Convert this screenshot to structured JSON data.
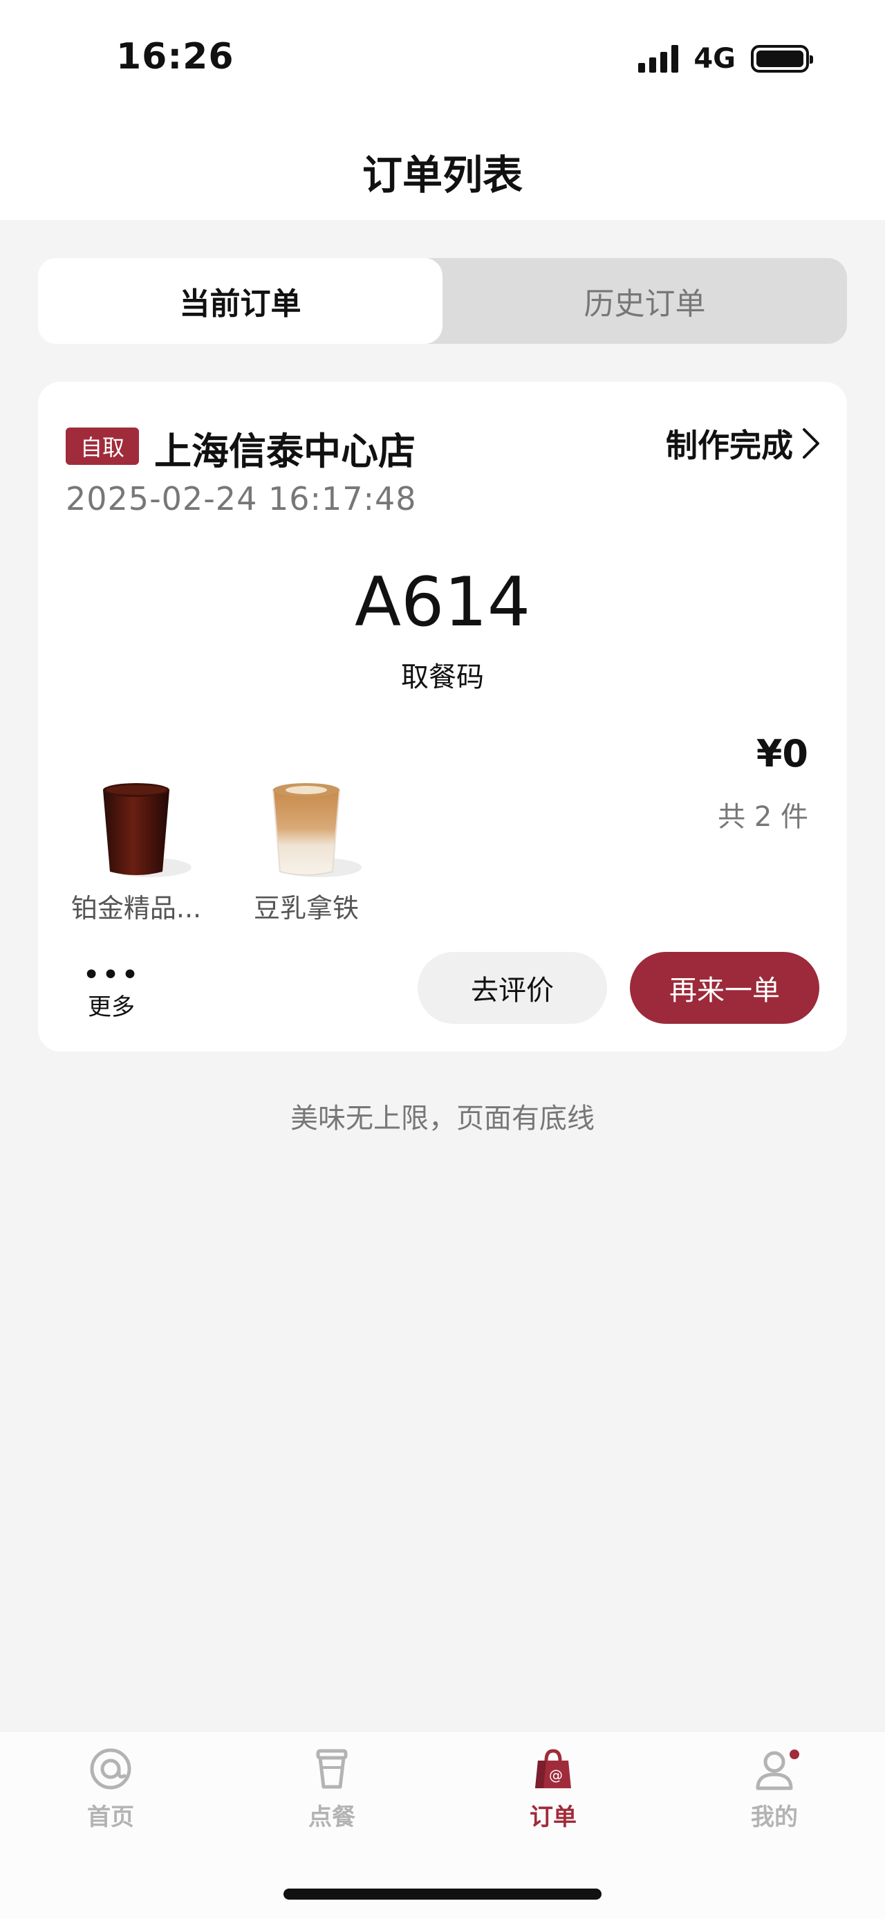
{
  "status_bar": {
    "time": "16:26",
    "network": "4G"
  },
  "header": {
    "title": "订单列表"
  },
  "tabs": [
    {
      "label": "当前订单",
      "active": true
    },
    {
      "label": "历史订单",
      "active": false
    }
  ],
  "order": {
    "pickup_badge": "自取",
    "store_name": "上海信泰中心店",
    "status": "制作完成",
    "datetime": "2025-02-24 16:17:48",
    "pickup_code": "A614",
    "pickup_code_label": "取餐码",
    "price": "¥0",
    "item_count": "共 2 件",
    "products": [
      {
        "name": "铂金精品...",
        "image": "black-coffee-cup"
      },
      {
        "name": "豆乳拿铁",
        "image": "latte-cup"
      }
    ],
    "more_label": "更多",
    "review_button": "去评价",
    "reorder_button": "再来一单"
  },
  "footer_note": "美味无上限，页面有底线",
  "tabbar": [
    {
      "label": "首页",
      "icon": "at-icon",
      "active": false
    },
    {
      "label": "点餐",
      "icon": "cup-icon",
      "active": false
    },
    {
      "label": "订单",
      "icon": "bag-icon",
      "active": true
    },
    {
      "label": "我的",
      "icon": "person-icon",
      "active": false,
      "badge": true
    }
  ],
  "colors": {
    "brand": "#a02c3b",
    "background": "#f4f4f4",
    "card": "#ffffff"
  }
}
